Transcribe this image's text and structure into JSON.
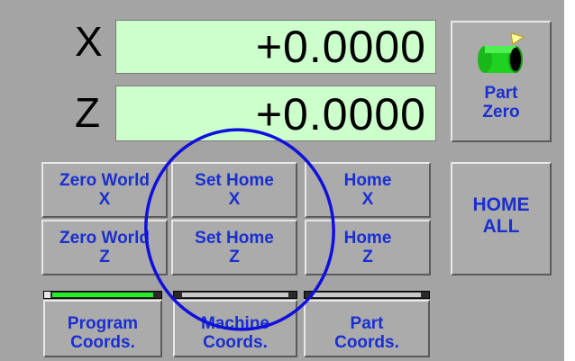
{
  "dro": {
    "x_label": "X",
    "x_value": "+0.0000",
    "z_label": "Z",
    "z_value": "+0.0000"
  },
  "part_zero": {
    "line1": "Part",
    "line2": "Zero",
    "icon": "cylinder-part-icon"
  },
  "buttons": {
    "zero_world_x": {
      "line1": "Zero World",
      "line2": "X"
    },
    "set_home_x": {
      "line1": "Set Home",
      "line2": "X"
    },
    "home_x": {
      "line1": "Home",
      "line2": "X"
    },
    "zero_world_z": {
      "line1": "Zero World",
      "line2": "Z"
    },
    "set_home_z": {
      "line1": "Set Home",
      "line2": "Z"
    },
    "home_z": {
      "line1": "Home",
      "line2": "Z"
    },
    "home_all": {
      "line1": "HOME",
      "line2": "ALL"
    }
  },
  "coords": {
    "program": {
      "line1": "Program",
      "line2": "Coords.",
      "active": true
    },
    "machine": {
      "line1": "Machine",
      "line2": "Coords.",
      "active": false
    },
    "part": {
      "line1": "Part",
      "line2": "Coords.",
      "active": false
    }
  },
  "colors": {
    "panel": "#a4a4a4",
    "dro_bg": "#ccffcc",
    "button_text": "#1a2fd0",
    "indicator_active": "#22ee22",
    "indicator_inactive": "#c8c8c8",
    "annotation_circle": "#1010dd"
  }
}
